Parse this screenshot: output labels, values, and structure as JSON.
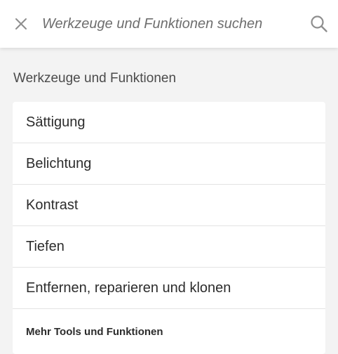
{
  "search": {
    "placeholder": "Werkzeuge und Funktionen suchen",
    "value": "",
    "close_icon": "close-icon",
    "search_icon": "magnifier-icon"
  },
  "section": {
    "title": "Werkzeuge und Funktionen"
  },
  "tools": {
    "items": [
      {
        "label": "Sättigung"
      },
      {
        "label": "Belichtung"
      },
      {
        "label": "Kontrast"
      },
      {
        "label": "Tiefen"
      },
      {
        "label": "Entfernen, reparieren und klonen"
      }
    ],
    "more_label": "Mehr Tools und Funktionen"
  },
  "colors": {
    "background": "#f3f3f3",
    "surface": "#ffffff",
    "text": "#2c2c2c",
    "icon": "#8e8e8e",
    "divider": "#e3e3e3"
  }
}
